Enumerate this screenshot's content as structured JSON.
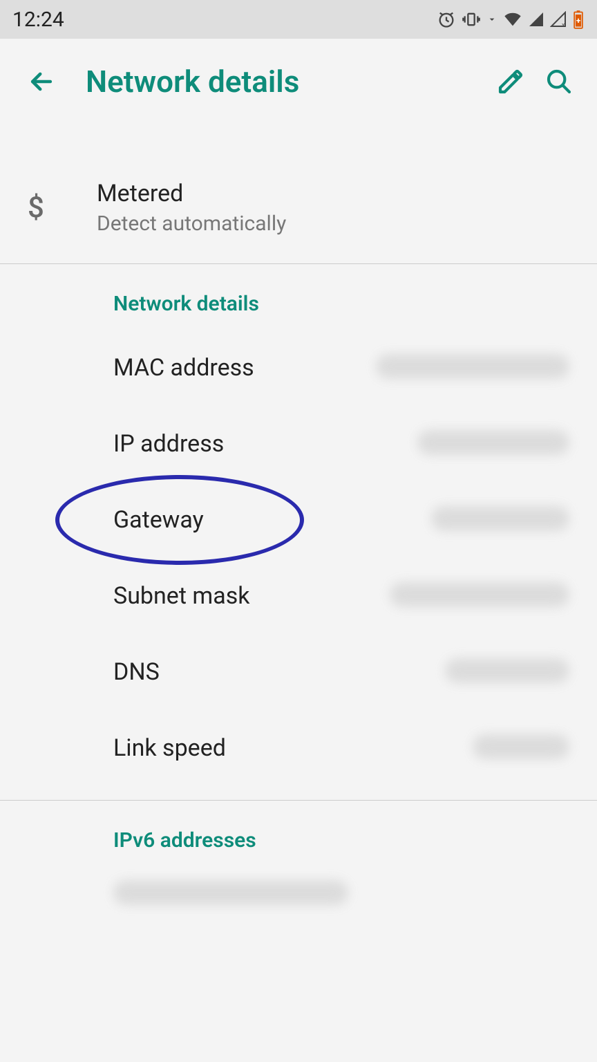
{
  "status": {
    "time": "12:24"
  },
  "header": {
    "title": "Network details"
  },
  "metered": {
    "label": "Metered",
    "sublabel": "Detect automatically"
  },
  "sections": {
    "network_details": {
      "title": "Network details",
      "items": [
        {
          "label": "MAC address"
        },
        {
          "label": "IP address"
        },
        {
          "label": "Gateway"
        },
        {
          "label": "Subnet mask"
        },
        {
          "label": "DNS"
        },
        {
          "label": "Link speed"
        }
      ]
    },
    "ipv6": {
      "title": "IPv6 addresses"
    }
  }
}
